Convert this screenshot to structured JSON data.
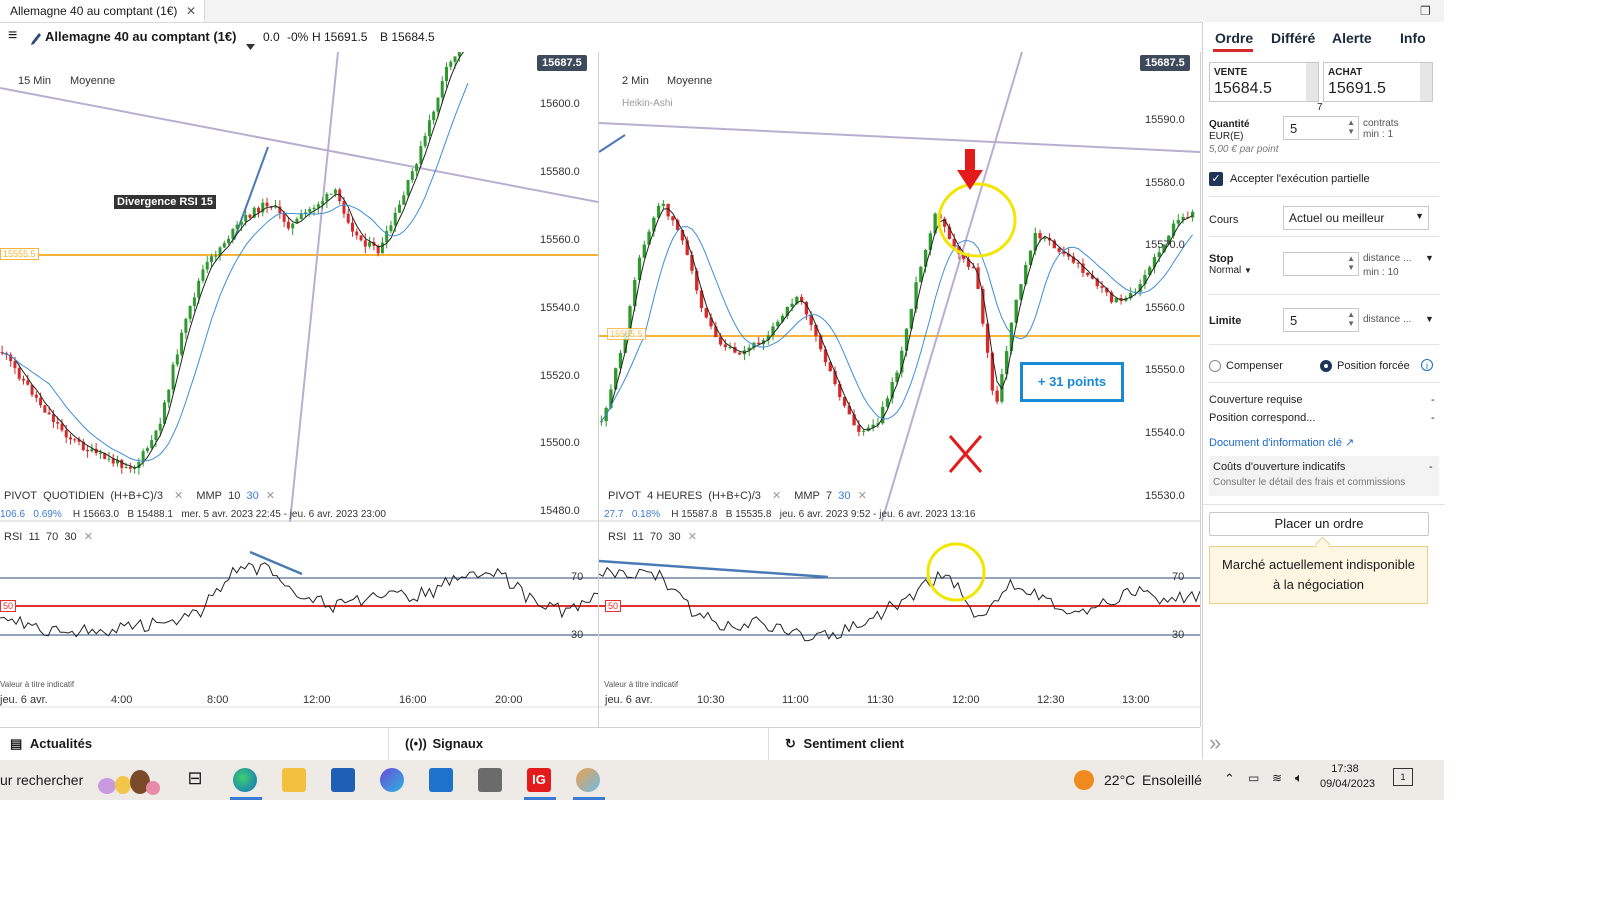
{
  "window": {
    "tab_title": "Allemagne 40 au comptant (1€)",
    "tab_close": "✕",
    "restore_glyph": "❐"
  },
  "header": {
    "menu_glyph": "≡",
    "instrument": "Allemagne 40 au comptant (1€)",
    "change": "0.0",
    "change_pct": "-0%",
    "high": "H 15691.5",
    "low": "B 15684.5"
  },
  "chart_left": {
    "timeframe": "15 Min",
    "average_label": "Moyenne",
    "price_tag": "15687.5",
    "annotation": "Divergence RSI 15",
    "level_tag": "15555.5",
    "y_ticks": [
      "15600.0",
      "15580.0",
      "15560.0",
      "15540.0",
      "15520.0",
      "15500.0",
      "15480.0"
    ],
    "pivot_label": "PIVOT",
    "pivot_period": "QUOTIDIEN",
    "pivot_formula": "(H+B+C)/3",
    "mmp_label": "MMP",
    "mmp_a": "10",
    "mmp_b": "30",
    "stat_a": "106.6",
    "stat_b": "0.69%",
    "stat_h": "H 15663.0",
    "stat_l": "B 15488.1",
    "range": "mer. 5 avr. 2023 22:45 - jeu. 6 avr. 2023 23:00",
    "rsi_label": "RSI",
    "rsi_a": "11",
    "rsi_b": "70",
    "rsi_c": "30",
    "rsi_70": "70",
    "rsi_50": "50",
    "rsi_30": "30",
    "disclaimer": "Valeur à titre indicatif",
    "x_ticks": [
      "jeu. 6 avr.",
      "4:00",
      "8:00",
      "12:00",
      "16:00",
      "20:00"
    ]
  },
  "chart_right": {
    "timeframe": "2 Min",
    "average_label": "Moyenne",
    "style_label": "Heikin-Ashi",
    "price_tag": "15687.5",
    "level_tag": "15555.5",
    "points_box": "+ 31 points",
    "y_ticks": [
      "15590.0",
      "15580.0",
      "15570.0",
      "15560.0",
      "15550.0",
      "15540.0",
      "15530.0"
    ],
    "pivot_label": "PIVOT",
    "pivot_period": "4 HEURES",
    "pivot_formula": "(H+B+C)/3",
    "mmp_label": "MMP",
    "mmp_a": "7",
    "mmp_b": "30",
    "stat_a": "27.7",
    "stat_b": "0.18%",
    "stat_h": "H 15587.8",
    "stat_l": "B 15535.8",
    "range": "jeu. 6 avr. 2023 9:52 - jeu. 6 avr. 2023 13:16",
    "rsi_label": "RSI",
    "rsi_a": "11",
    "rsi_b": "70",
    "rsi_c": "30",
    "rsi_70": "70",
    "rsi_50": "50",
    "rsi_30": "30",
    "disclaimer": "Valeur à titre indicatif",
    "x_ticks": [
      "jeu. 6 avr.",
      "10:30",
      "11:00",
      "11:30",
      "12:00",
      "12:30",
      "13:00"
    ]
  },
  "bottom_bar": {
    "news": "Actualités",
    "signals": "Signaux",
    "sentiment": "Sentiment client"
  },
  "panel": {
    "tabs": [
      "Ordre",
      "Différé",
      "Alerte",
      "Info"
    ],
    "sell_label": "VENTE",
    "sell_price": "15684.5",
    "buy_label": "ACHAT",
    "buy_price": "15691.5",
    "spread": "7",
    "qty_label": "Quantité",
    "qty_unit": "EUR(E)",
    "qty_value": "5",
    "qty_side1": "contrats",
    "qty_side2": "min : 1",
    "per_point": "5,00 € par point",
    "partial_label": "Accepter l'exécution partielle",
    "partial_checked": true,
    "cours_label": "Cours",
    "cours_value": "Actuel ou meilleur",
    "stop_label": "Stop",
    "stop_type": "Normal",
    "stop_value": "",
    "stop_side1": "distance ...",
    "stop_side2": "min : 10",
    "limit_label": "Limite",
    "limit_value": "5",
    "limit_side": "distance ...",
    "radio_a": "Compenser",
    "radio_b": "Position forcée",
    "cover_label": "Couverture requise",
    "cover_value": "-",
    "position_label": "Position correspond...",
    "position_value": "-",
    "doc_link": "Document d'information clé",
    "costs_title": "Coûts d'ouverture indicatifs",
    "costs_value": "-",
    "costs_detail": "Consulter le détail des frais et commissions",
    "place_order": "Placer un ordre",
    "market_msg_1": "Marché actuellement indisponible",
    "market_msg_2": "à la négociation",
    "expand_glyph": "»"
  },
  "taskbar": {
    "search": "ur rechercher",
    "weather_temp": "22°C",
    "weather_text": "Ensoleillé",
    "time": "17:38",
    "date": "09/04/2023",
    "ig_label": "IG",
    "notif_count": "1"
  },
  "colors": {
    "bull": "#2e9a2e",
    "bear": "#d42a2a",
    "support": "#f5b338",
    "rsi_mid": "#e03030",
    "ma_fast": "#222222",
    "ma_slow": "#3d8ed8",
    "trend": "#b9aed0",
    "highlight": "#f2e600",
    "accent": "#1a8ad4"
  }
}
